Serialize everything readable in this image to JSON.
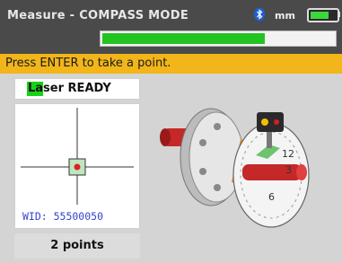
{
  "header": {
    "title": "Measure - COMPASS MODE",
    "unit": "mm",
    "progress_value": 0.7,
    "battery_level": 0.7
  },
  "instruction": "Press ENTER to take a point.",
  "laser": {
    "status": "Laser READY"
  },
  "target": {
    "wid_text": "WID: 55500050"
  },
  "points_label": "2 points",
  "colors": {
    "title_bar": "#4a4a4a",
    "instruction_bar": "#f2b51a",
    "progress": "#23c321",
    "laser_ready": "#17d117",
    "wid_text": "#3344cc"
  },
  "icons": [
    "bluetooth-icon",
    "battery-icon",
    "crosshair-icon",
    "shaft-illustration"
  ]
}
